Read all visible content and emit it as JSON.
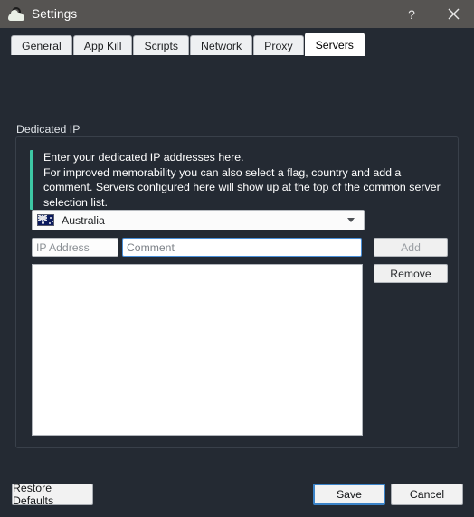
{
  "window": {
    "title": "Settings",
    "icon": "cloud-lock-icon",
    "help_label": "?",
    "close_label": "✕"
  },
  "tabs": [
    {
      "label": "General",
      "active": false
    },
    {
      "label": "App Kill",
      "active": false
    },
    {
      "label": "Scripts",
      "active": false
    },
    {
      "label": "Network",
      "active": false
    },
    {
      "label": "Proxy",
      "active": false
    },
    {
      "label": "Servers",
      "active": true
    }
  ],
  "servers_panel": {
    "group_label": "Dedicated IP",
    "info_text": "Enter your dedicated IP addresses here.\nFor improved memorability you can also select a flag, country and add a comment. Servers configured here will show up at the top of the common server selection list.",
    "info_accent_color": "#3dc7a4",
    "country_select": {
      "selected": "Australia",
      "flag": "australia-flag-icon"
    },
    "ip_field": {
      "value": "",
      "placeholder": "IP Address"
    },
    "comment_field": {
      "value": "",
      "placeholder": "Comment",
      "focused": true,
      "focus_color": "#4a90d9"
    },
    "add_button": {
      "label": "Add",
      "enabled": false
    },
    "remove_button": {
      "label": "Remove",
      "enabled": true
    },
    "server_list": {
      "columns": [],
      "rows": []
    }
  },
  "footer": {
    "restore_label": "Restore Defaults",
    "save_label": "Save",
    "cancel_label": "Cancel",
    "default_button_color": "#3b83c8"
  }
}
